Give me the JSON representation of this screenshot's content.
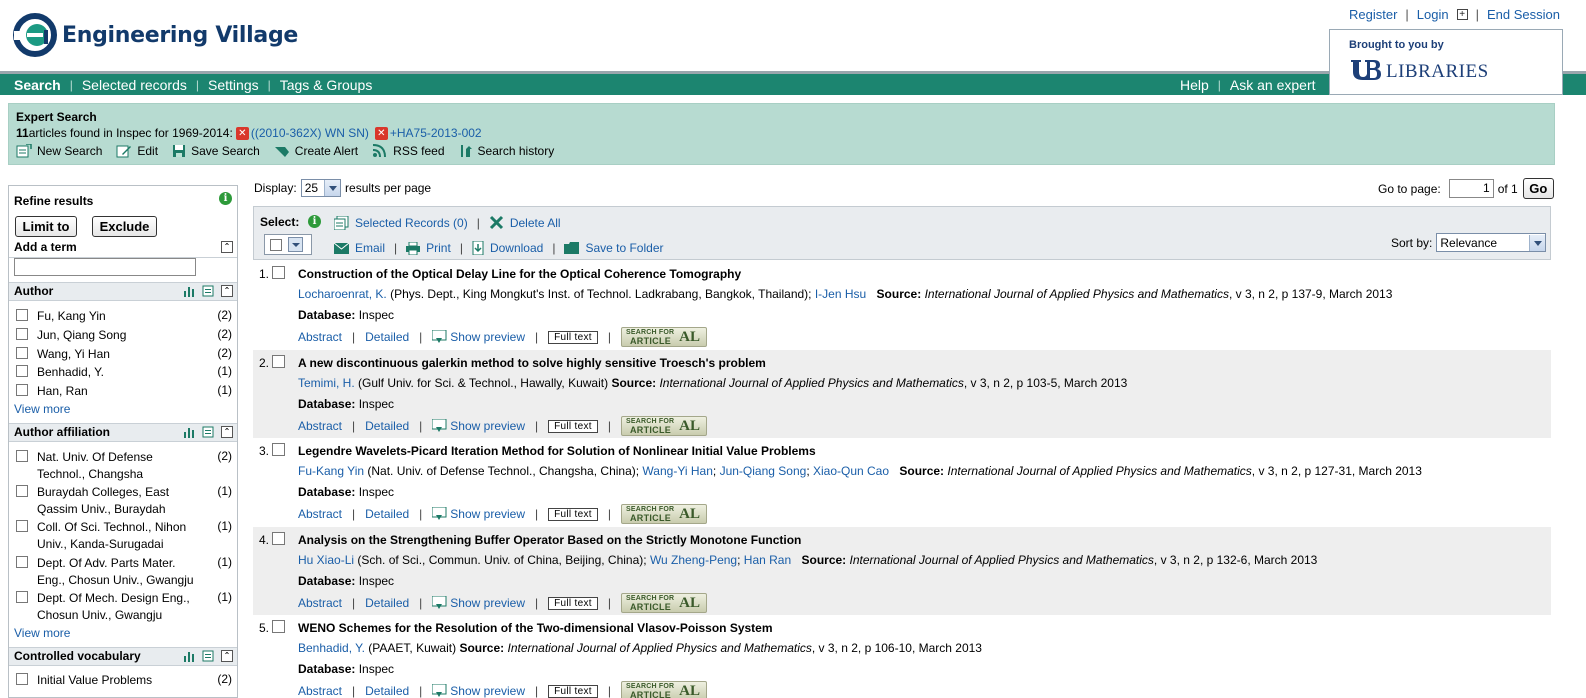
{
  "header": {
    "logo_text": "Engineering Village",
    "register": "Register",
    "login": "Login",
    "end_session": "End Session",
    "plus": "+",
    "brought_to_you": "Brought to you by",
    "libraries": "LIBRARIES"
  },
  "nav": {
    "search": "Search",
    "selected_records": "Selected records",
    "settings": "Settings",
    "tags_groups": "Tags & Groups",
    "help": "Help",
    "ask_expert": "Ask an expert",
    "sep": "|"
  },
  "expert": {
    "title": "Expert Search",
    "count": "11",
    "found_text": " articles found in Inspec for 1969-2014:",
    "term1": "((2010-362X) WN SN)",
    "term2": "+HA75-2013-002",
    "tools": {
      "new_search": "New Search",
      "edit": "Edit",
      "save_search": "Save Search",
      "create_alert": "Create Alert",
      "rss_feed": "RSS feed",
      "search_history": "Search history"
    }
  },
  "sidebar": {
    "refine_title": "Refine results",
    "limit_to": "Limit to",
    "exclude": "Exclude",
    "add_term": "Add a term",
    "author_head": "Author",
    "authors": [
      {
        "name": "Fu, Kang Yin",
        "count": "(2)"
      },
      {
        "name": "Jun, Qiang Song",
        "count": "(2)"
      },
      {
        "name": "Wang, Yi Han",
        "count": "(2)"
      },
      {
        "name": "Benhadid, Y.",
        "count": "(1)"
      },
      {
        "name": "Han, Ran",
        "count": "(1)"
      }
    ],
    "view_more": "View more",
    "affil_head": "Author affiliation",
    "affiliations": [
      {
        "name": "Nat. Univ. Of Defense Technol., Changsha",
        "count": "(2)"
      },
      {
        "name": "Buraydah Colleges, East Qassim Univ., Buraydah",
        "count": "(1)"
      },
      {
        "name": "Coll. Of Sci. Technol., Nihon Univ., Kanda-Surugadai",
        "count": "(1)"
      },
      {
        "name": "Dept. Of Adv. Parts Mater. Eng., Chosun Univ., Gwangju",
        "count": "(1)"
      },
      {
        "name": "Dept. Of Mech. Design Eng., Chosun Univ., Gwangju",
        "count": "(1)"
      }
    ],
    "vocab_head": "Controlled vocabulary",
    "vocab": [
      {
        "name": "Initial Value Problems",
        "count": "(2)"
      }
    ]
  },
  "display": {
    "label": "Display:",
    "value": "25",
    "suffix": "results per page",
    "goto_label": "Go to page:",
    "page": "1",
    "of": "of 1",
    "go": "Go"
  },
  "toolbar": {
    "select": "Select:",
    "selected_records": "Selected Records (0)",
    "delete_all": "Delete All",
    "email": "Email",
    "print": "Print",
    "download": "Download",
    "save_folder": "Save to Folder",
    "sort_by": "Sort by:",
    "sort_value": "Relevance"
  },
  "record_labels": {
    "source": "Source:",
    "database": "Database:",
    "abstract": "Abstract",
    "detailed": "Detailed",
    "show_preview": "Show preview",
    "full_text": "Full text",
    "sfa_top": "SEARCH FOR",
    "sfa_bottom": "ARTICLE",
    "sfa_logo": "AL"
  },
  "records": [
    {
      "num": "1.",
      "title": "Construction of the Optical Delay Line for the Optical Coherence Tomography",
      "author1": "Locharoenrat, K.",
      "affil": " (Phys. Dept., King Mongkut's Inst. of Technol. Ladkrabang, Bangkok, Thailand); ",
      "author2": "I-Jen Hsu",
      "author3": "",
      "author4": "",
      "journal": "International Journal of Applied Physics and Mathematics",
      "details": ", v 3, n 2, p 137-9, March 2013",
      "database": "Inspec"
    },
    {
      "num": "2.",
      "title": "A new discontinuous galerkin method to solve highly sensitive Troesch's problem",
      "author1": "Temimi, H.",
      "affil": " (Gulf Univ. for Sci. & Technol., Hawally, Kuwait) ",
      "author2": "",
      "author3": "",
      "author4": "",
      "journal": "International Journal of Applied Physics and Mathematics",
      "details": ", v 3, n 2, p 103-5, March 2013",
      "database": "Inspec"
    },
    {
      "num": "3.",
      "title": "Legendre Wavelets-Picard Iteration Method for Solution of Nonlinear Initial Value Problems",
      "author1": "Fu-Kang Yin",
      "affil": " (Nat. Univ. of Defense Technol., Changsha, China); ",
      "author2": "Wang-Yi Han",
      "author3": "Jun-Qiang Song",
      "author4": "Xiao-Qun Cao",
      "journal": "International Journal of Applied Physics and Mathematics",
      "details": ", v 3, n 2, p 127-31, March 2013",
      "database": "Inspec"
    },
    {
      "num": "4.",
      "title": "Analysis on the Strengthening Buffer Operator Based on the Strictly Monotone Function",
      "author1": "Hu Xiao-Li",
      "affil": " (Sch. of Sci., Commun. Univ. of China, Beijing, China); ",
      "author2": "Wu Zheng-Peng",
      "author3": "Han Ran",
      "author4": "",
      "journal": "International Journal of Applied Physics and Mathematics",
      "details": ", v 3, n 2, p 132-6, March 2013",
      "database": "Inspec"
    },
    {
      "num": "5.",
      "title": "WENO Schemes for the Resolution of the Two-dimensional Vlasov-Poisson System",
      "author1": "Benhadid, Y.",
      "affil": " (PAAET, Kuwait) ",
      "author2": "",
      "author3": "",
      "author4": "",
      "journal": "International Journal of Applied Physics and Mathematics",
      "details": ", v 3, n 2, p 106-10, March 2013",
      "database": "Inspec"
    }
  ]
}
